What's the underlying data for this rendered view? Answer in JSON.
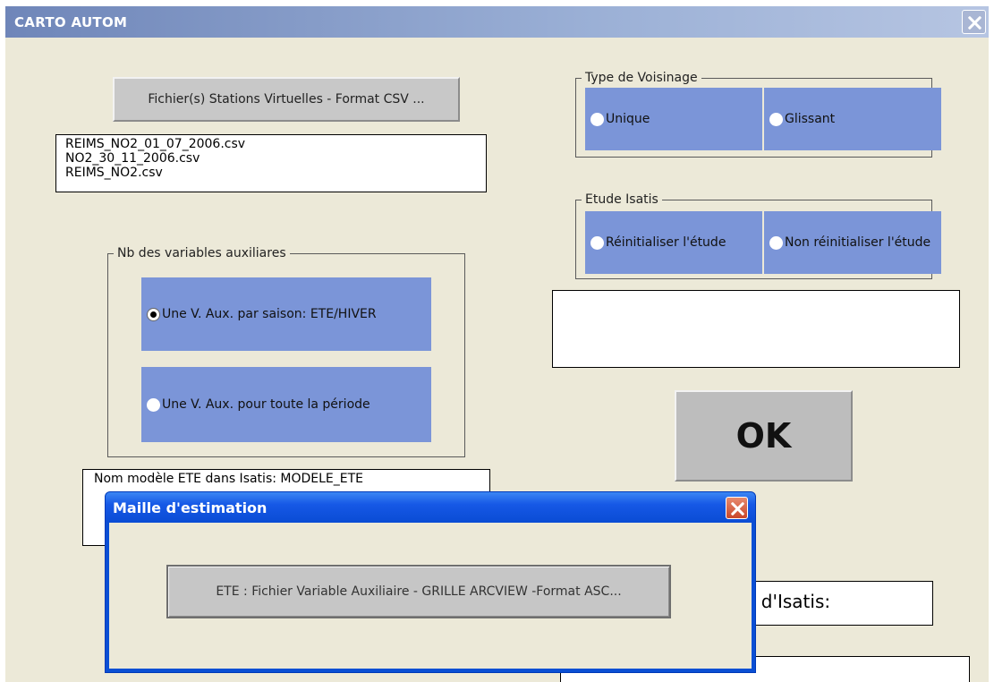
{
  "window": {
    "title": "CARTO AUTOM"
  },
  "files": {
    "button_label": "Fichier(s) Stations Virtuelles - Format CSV ...",
    "list": [
      "REIMS_NO2_01_07_2006.csv",
      "NO2_30_11_2006.csv",
      "REIMS_NO2.csv"
    ]
  },
  "aux_vars": {
    "legend": "Nb des variables auxiliares",
    "options": [
      {
        "label": "Une V. Aux. par saison: ETE/HIVER",
        "selected": true
      },
      {
        "label": "Une V. Aux. pour toute la période",
        "selected": false
      }
    ]
  },
  "model_box": {
    "line1": "Nom modèle ETE dans Isatis: MODELE_ETE"
  },
  "voisinage": {
    "legend": "Type de Voisinage",
    "options": [
      {
        "label": "Unique",
        "selected": false
      },
      {
        "label": "Glissant",
        "selected": false
      }
    ]
  },
  "etude": {
    "legend": "Etude Isatis",
    "options": [
      {
        "label": "Réinitialiser l'étude",
        "selected": false
      },
      {
        "label": "Non réinitialiser l'étude",
        "selected": false
      }
    ]
  },
  "ok_label": "OK",
  "isatis_partial": "s d'Isatis:",
  "dialog": {
    "title": "Maille d'estimation",
    "button_label": "ETE : Fichier Variable Auxiliaire - GRILLE ARCVIEW -Format ASC..."
  },
  "colors": {
    "option_blue": "#7b95d8",
    "xp_blue": "#0a4fd4",
    "window_bg": "#ece9d8"
  }
}
